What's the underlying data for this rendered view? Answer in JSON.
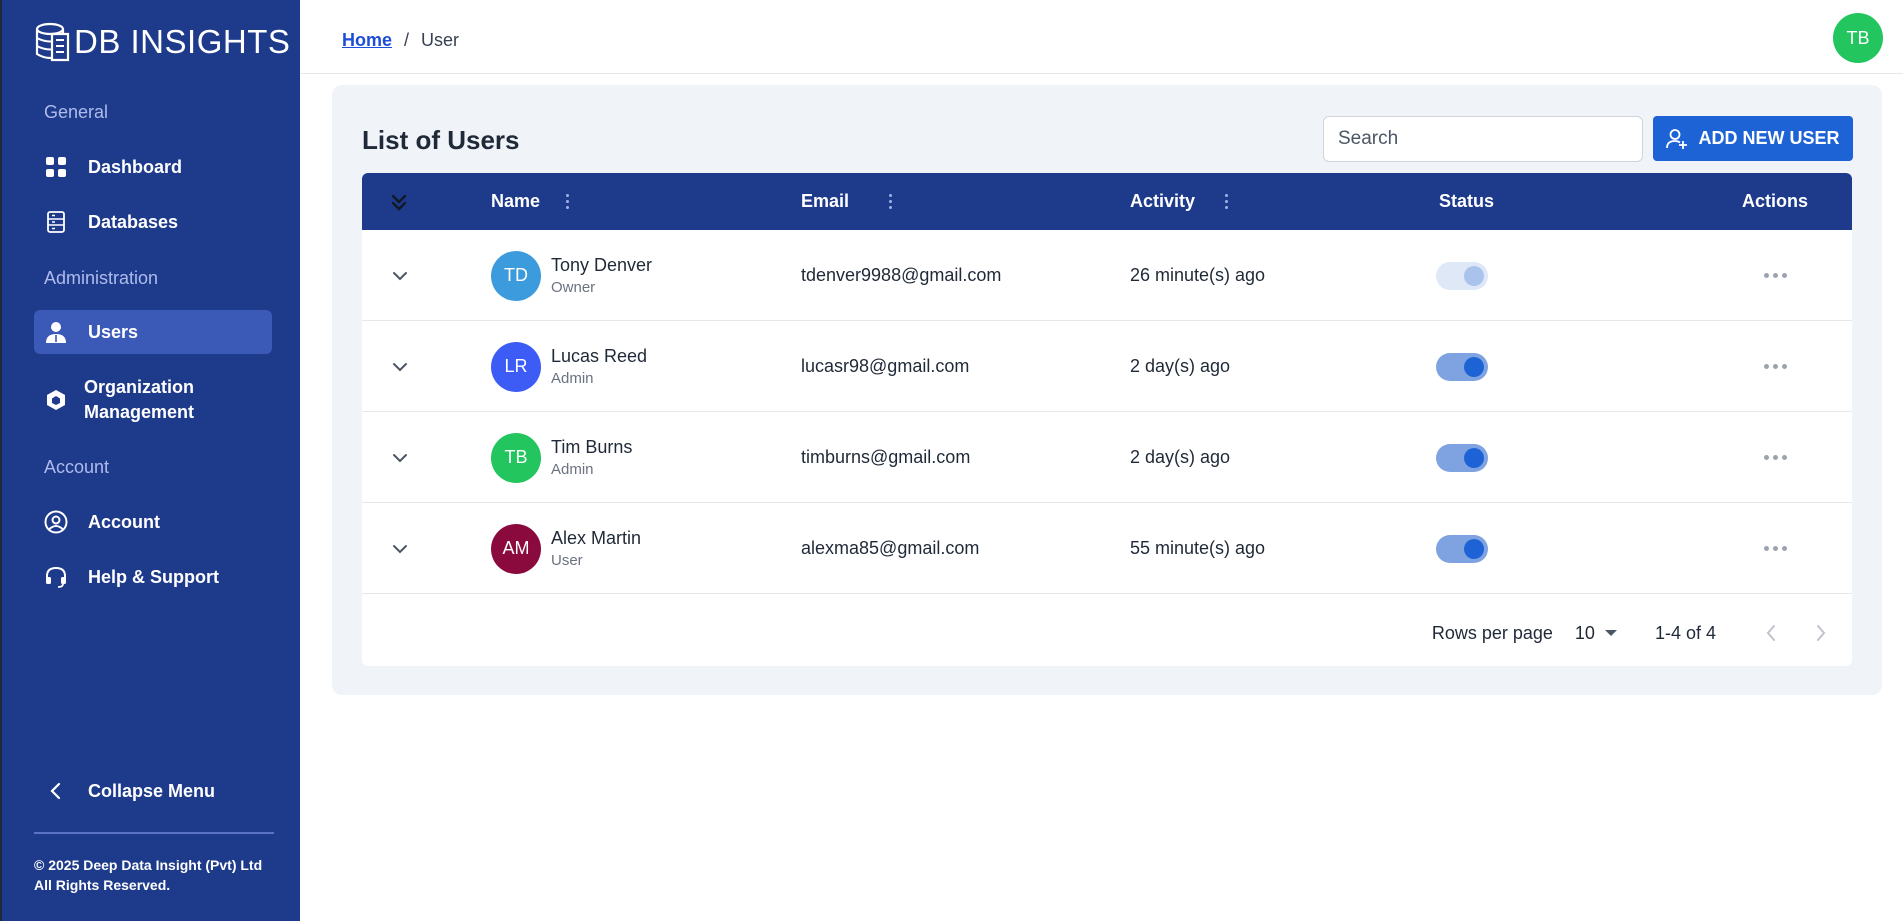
{
  "sidebar": {
    "logo_text": "DB INSIGHTS",
    "sections": {
      "general": "General",
      "administration": "Administration",
      "account": "Account"
    },
    "items": {
      "dashboard": "Dashboard",
      "databases": "Databases",
      "users": "Users",
      "organization_line1": "Organization",
      "organization_line2": "Management",
      "account": "Account",
      "help": "Help & Support",
      "collapse": "Collapse Menu"
    },
    "copyright_line1": "© 2025 Deep Data Insight (Pvt) Ltd",
    "copyright_line2": "All Rights Reserved.",
    "active_item": "Users",
    "bg_color": "#1e3a8a"
  },
  "header": {
    "breadcrumb_home": "Home",
    "breadcrumb_sep": "/",
    "breadcrumb_current": "User",
    "avatar_initials": "TB"
  },
  "main": {
    "title": "List of Users",
    "search_placeholder": "Search",
    "add_button": "ADD NEW USER",
    "columns": {
      "name": "Name",
      "email": "Email",
      "activity": "Activity",
      "status": "Status",
      "actions": "Actions"
    },
    "users": [
      {
        "initials": "TD",
        "name": "Tony Denver",
        "role": "Owner",
        "email": "tdenver9988@gmail.com",
        "activity": "26 minute(s) ago",
        "avatar_color": "#3b9bdc",
        "status_on": true,
        "status_disabled": true
      },
      {
        "initials": "LR",
        "name": "Lucas Reed",
        "role": "Admin",
        "email": "lucasr98@gmail.com",
        "activity": "2 day(s) ago",
        "avatar_color": "#3d5cf5",
        "status_on": true,
        "status_disabled": false
      },
      {
        "initials": "TB",
        "name": "Tim Burns",
        "role": "Admin",
        "email": "timburns@gmail.com",
        "activity": "2 day(s) ago",
        "avatar_color": "#22c55e",
        "status_on": true,
        "status_disabled": false
      },
      {
        "initials": "AM",
        "name": "Alex Martin",
        "role": "User",
        "email": "alexma85@gmail.com",
        "activity": "55 minute(s) ago",
        "avatar_color": "#8b0a3e",
        "status_on": true,
        "status_disabled": false
      }
    ],
    "pagination": {
      "rows_label": "Rows per page",
      "rows_value": "10",
      "range": "1-4 of 4"
    }
  }
}
